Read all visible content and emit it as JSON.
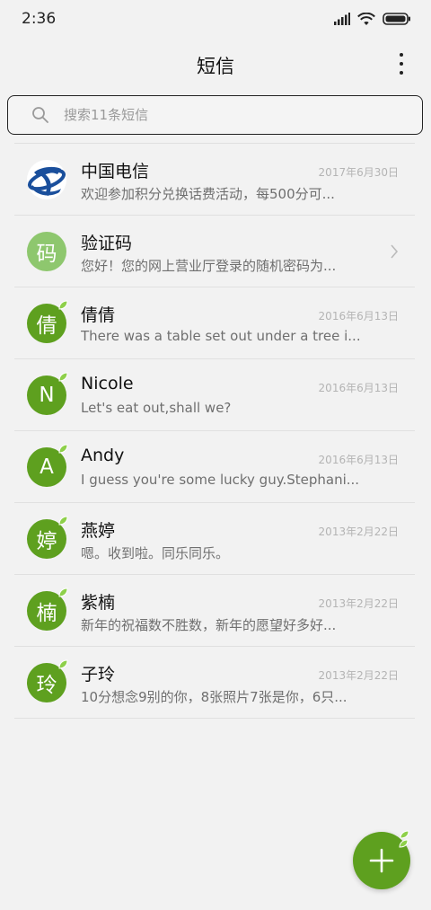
{
  "status_bar": {
    "time": "2:36"
  },
  "header": {
    "title": "短信"
  },
  "search": {
    "placeholder": "搜索11条短信"
  },
  "conversations": [
    {
      "name": "中国电信",
      "date": "2017年6月30日",
      "preview": "欢迎参加积分兑换话费活动，每500分可...",
      "avatar_type": "logo",
      "avatar_icon": "china-telecom-logo"
    },
    {
      "name": "验证码",
      "date": "",
      "preview": "您好！您的网上营业厅登录的随机密码为...",
      "avatar_char": "码",
      "avatar_type": "lightgreen",
      "has_chevron": true
    },
    {
      "name": "倩倩",
      "date": "2016年6月13日",
      "preview": "There was a table set out under a tree i...",
      "avatar_char": "倩",
      "avatar_type": "green"
    },
    {
      "name": "Nicole",
      "date": "2016年6月13日",
      "preview": "Let's eat out,shall we?",
      "avatar_char": "N",
      "avatar_type": "green"
    },
    {
      "name": "Andy",
      "date": "2016年6月13日",
      "preview": "I guess you're some lucky guy.Stephani...",
      "avatar_char": "A",
      "avatar_type": "green"
    },
    {
      "name": "燕婷",
      "date": "2013年2月22日",
      "preview": "嗯。收到啦。同乐同乐。",
      "avatar_char": "婷",
      "avatar_type": "green"
    },
    {
      "name": "紫楠",
      "date": "2013年2月22日",
      "preview": "新年的祝福数不胜数，新年的愿望好多好...",
      "avatar_char": "楠",
      "avatar_type": "green"
    },
    {
      "name": "子玲",
      "date": "2013年2月22日",
      "preview": "10分想念9别的你，8张照片7张是你，6只...",
      "avatar_char": "玲",
      "avatar_type": "green"
    }
  ],
  "colors": {
    "accent": "#5ea01f",
    "avatar_light": "#8ec76e",
    "background": "#f2f2f2"
  },
  "fab": {
    "icon": "plus-icon"
  }
}
